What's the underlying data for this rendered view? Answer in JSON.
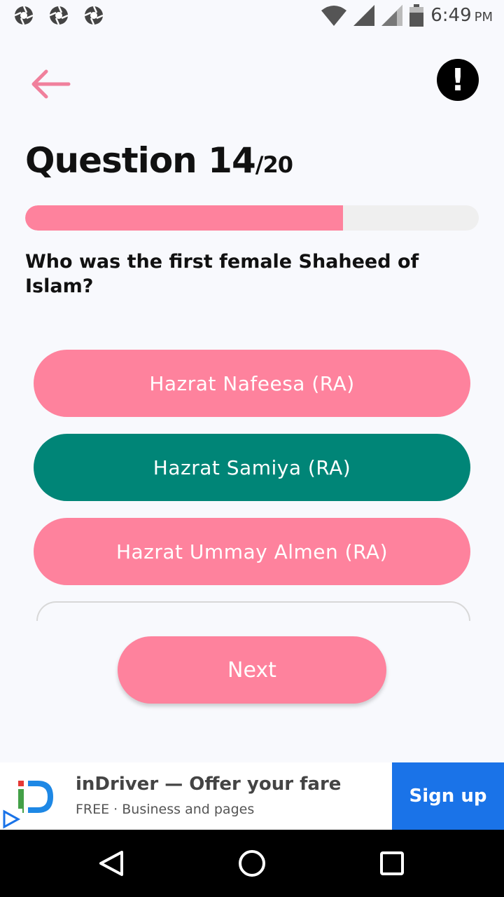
{
  "status_bar": {
    "time": "6:49",
    "ampm": "PM",
    "left_icons": [
      "aperture-icon",
      "aperture-icon",
      "aperture-icon"
    ],
    "right_icons": [
      "wifi-icon",
      "signal-icon",
      "signal-icon",
      "battery-icon"
    ]
  },
  "header": {
    "back_icon": "arrow-left-icon",
    "info_icon": "exclamation-icon",
    "info_label": "!"
  },
  "quiz": {
    "title": "Question 14",
    "total": "/20",
    "progress": 0.7,
    "question": "Who was the first female Shaheed of Islam?",
    "options": [
      {
        "label": "Hazrat Nafeesa (RA)",
        "state": "default"
      },
      {
        "label": "Hazrat Samiya (RA)",
        "state": "selected"
      },
      {
        "label": "Hazrat Ummay Almen (RA)",
        "state": "default"
      }
    ],
    "next_label": "Next"
  },
  "ad": {
    "title": "inDriver — Offer your fare",
    "subtitle": "FREE · Business and pages",
    "cta": "Sign up"
  },
  "colors": {
    "accent": "#fe829d",
    "selected": "#008577",
    "ad_button": "#1a73e8"
  }
}
